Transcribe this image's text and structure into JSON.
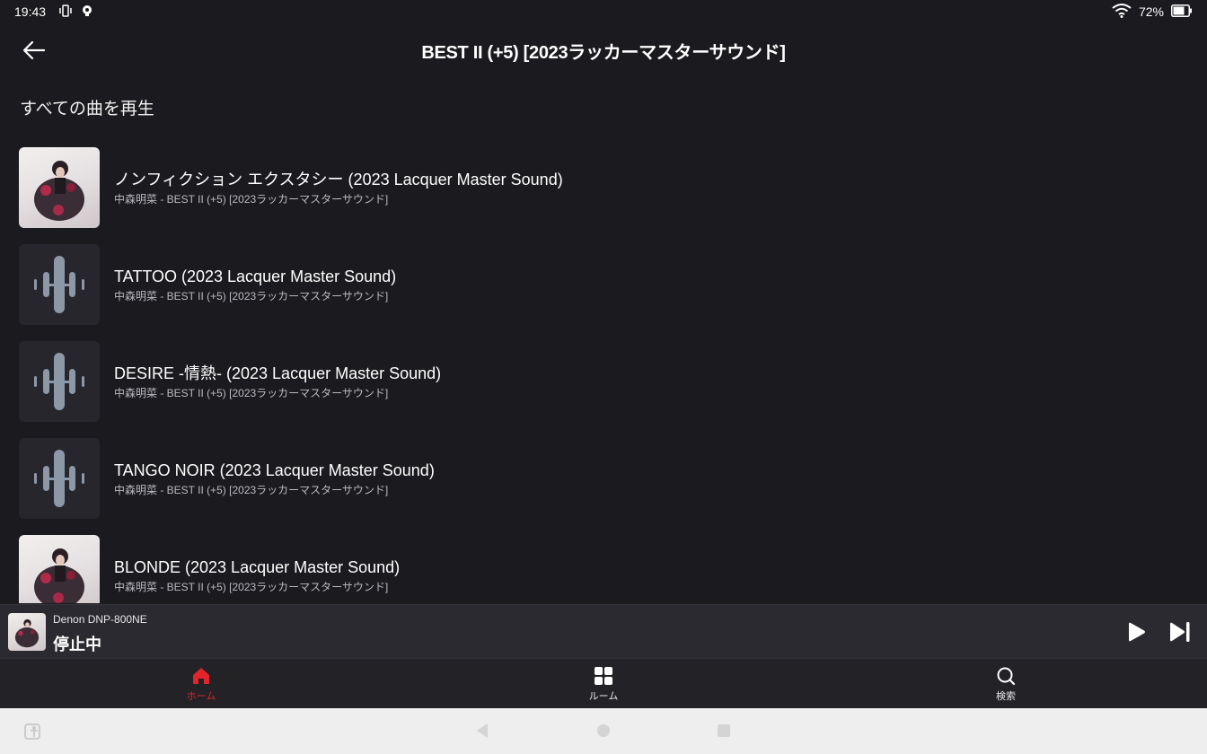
{
  "status_bar": {
    "time": "19:43",
    "battery": "72%"
  },
  "header": {
    "title": "BEST II (+5) [2023ラッカーマスターサウンド]"
  },
  "play_all_label": "すべての曲を再生",
  "tracks": [
    {
      "title": "ノンフィクション エクスタシー (2023 Lacquer Master Sound)",
      "subtitle": "中森明菜 - BEST II (+5) [2023ラッカーマスターサウンド]",
      "art": "album-art"
    },
    {
      "title": "TATTOO (2023 Lacquer Master Sound)",
      "subtitle": "中森明菜 - BEST II (+5) [2023ラッカーマスターサウンド]",
      "art": "placeholder-waveform-icon"
    },
    {
      "title": "DESIRE -情熱- (2023 Lacquer Master Sound)",
      "subtitle": "中森明菜 - BEST II (+5) [2023ラッカーマスターサウンド]",
      "art": "placeholder-waveform-icon"
    },
    {
      "title": "TANGO NOIR (2023 Lacquer Master Sound)",
      "subtitle": "中森明菜 - BEST II (+5) [2023ラッカーマスターサウンド]",
      "art": "placeholder-waveform-icon"
    },
    {
      "title": "BLONDE (2023 Lacquer Master Sound)",
      "subtitle": "中森明菜 - BEST II (+5) [2023ラッカーマスターサウンド]",
      "art": "album-art"
    }
  ],
  "now_playing": {
    "device": "Denon DNP-800NE",
    "status": "停止中"
  },
  "bottom_nav": {
    "home": "ホーム",
    "rooms": "ルーム",
    "search": "検索"
  },
  "colors": {
    "accent": "#e3242b",
    "background": "#1b1b1f"
  }
}
